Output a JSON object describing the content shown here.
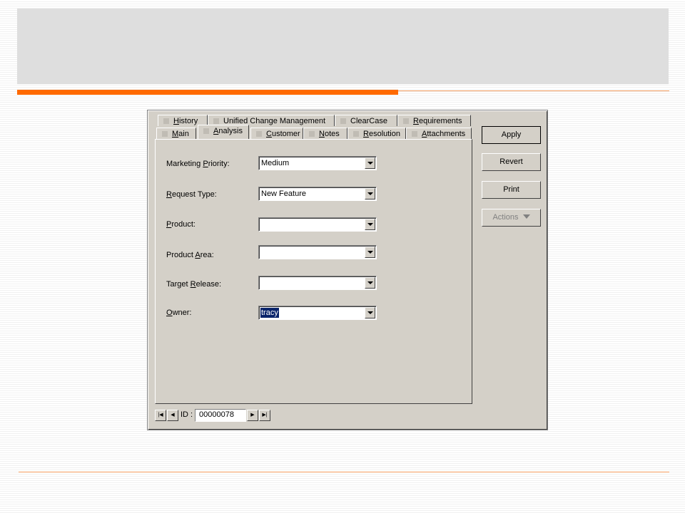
{
  "dialog": {
    "tabs_row1": [
      {
        "label": "History",
        "ul": "H",
        "rest": "istory"
      },
      {
        "label": "Unified Change Management",
        "ul": "",
        "rest": "Unified Change Management"
      },
      {
        "label": "ClearCase",
        "ul": "",
        "rest": "ClearCase"
      },
      {
        "label": "Requirements",
        "ul": "R",
        "rest": "equirements"
      }
    ],
    "tabs_row2": [
      {
        "label": "Main",
        "ul": "M",
        "rest": "ain"
      },
      {
        "label": "Analysis",
        "ul": "A",
        "rest": "nalysis"
      },
      {
        "label": "Customer",
        "ul": "C",
        "rest": "ustomer"
      },
      {
        "label": "Notes",
        "ul": "N",
        "rest": "otes"
      },
      {
        "label": "Resolution",
        "ul": "R",
        "rest": "esolution"
      },
      {
        "label": "Attachments",
        "ul": "A",
        "rest": "ttachments"
      }
    ],
    "active_tab": "Analysis",
    "fields": [
      {
        "pre": "Marketing ",
        "ul": "P",
        "post": "riority:",
        "value": ""
      },
      {
        "pre": "",
        "ul": "R",
        "post": "equest Type:",
        "value": ""
      },
      {
        "pre": "",
        "ul": "P",
        "post": "roduct:",
        "value": ""
      },
      {
        "pre": "Product ",
        "ul": "A",
        "post": "rea:",
        "value": ""
      },
      {
        "pre": "Target ",
        "ul": "R",
        "post": "elease:",
        "value": ""
      },
      {
        "pre": "",
        "ul": "O",
        "post": "wner:",
        "value": ""
      }
    ],
    "field_values": {
      "marketing_priority": "Medium",
      "request_type": "New Feature",
      "product": "",
      "product_area": "",
      "target_release": "",
      "owner": "tracy"
    },
    "buttons": {
      "apply": "Apply",
      "revert": "Revert",
      "print": "Print",
      "actions": "Actions"
    },
    "record_nav": {
      "id_label": "ID :",
      "id_value": "00000078"
    }
  },
  "colors": {
    "accent_orange": "#ff6a00",
    "dialog_face": "#d4d0c8",
    "selection": "#0a246a"
  }
}
